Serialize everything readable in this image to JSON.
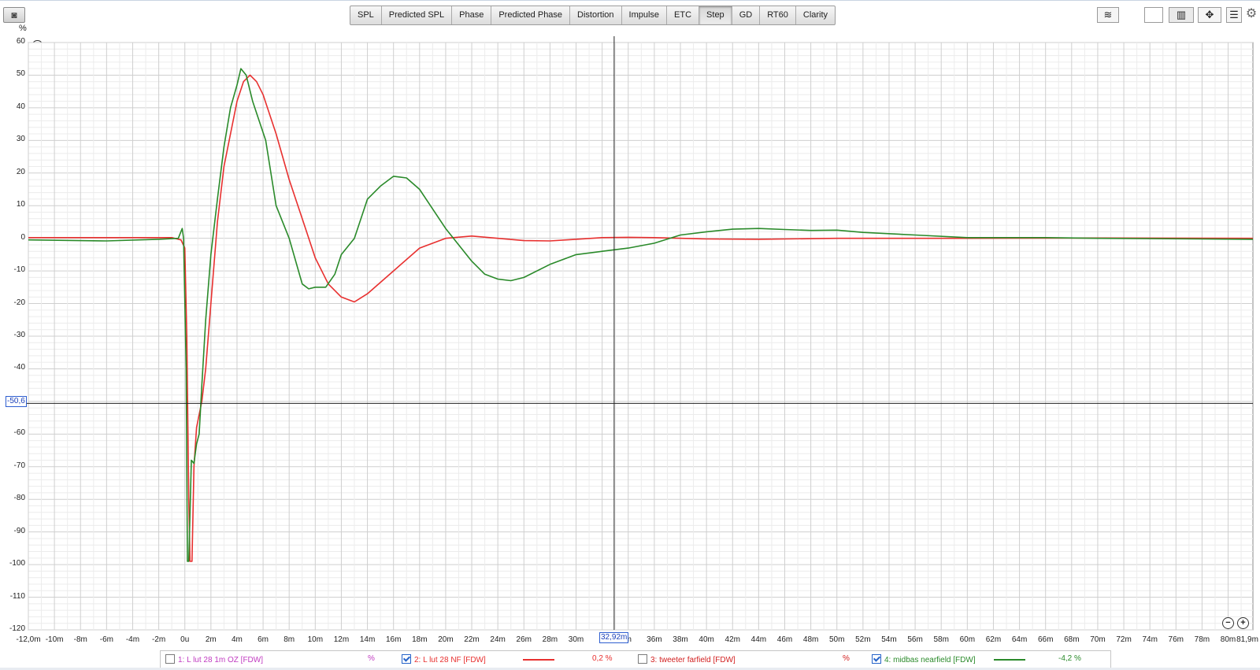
{
  "toolbar": {
    "tabs": [
      {
        "label": "SPL",
        "active": false
      },
      {
        "label": "Predicted SPL",
        "active": false
      },
      {
        "label": "Phase",
        "active": false
      },
      {
        "label": "Predicted Phase",
        "active": false
      },
      {
        "label": "Distortion",
        "active": false
      },
      {
        "label": "Impulse",
        "active": false
      },
      {
        "label": "ETC",
        "active": false
      },
      {
        "label": "Step",
        "active": true
      },
      {
        "label": "GD",
        "active": false
      },
      {
        "label": "RT60",
        "active": false
      },
      {
        "label": "Clarity",
        "active": false
      }
    ]
  },
  "unit_label": "%",
  "unit_select": "%",
  "cursor": {
    "y_readout": "-50,6",
    "x_readout": "32,92m"
  },
  "chart_data": {
    "type": "line",
    "ylim": [
      -120,
      60
    ],
    "xlim": [
      -12.0,
      81.9
    ],
    "grid": true,
    "y_ticks": [
      60,
      50,
      40,
      30,
      20,
      10,
      0,
      -10,
      -20,
      -30,
      -40,
      -50,
      -60,
      -70,
      -80,
      -90,
      -100,
      -110,
      -120
    ],
    "y_tick_labels": [
      "60",
      "50",
      "40",
      "30",
      "20",
      "10",
      "0",
      "-10",
      "-20",
      "-30",
      "-40",
      "",
      "-60",
      "-70",
      "-80",
      "-90",
      "-100",
      "-110",
      "-120"
    ],
    "x_ticks": [
      -12,
      -10,
      -8,
      -6,
      -4,
      -2,
      0,
      2,
      4,
      6,
      8,
      10,
      12,
      14,
      16,
      18,
      20,
      22,
      24,
      26,
      28,
      30,
      32,
      34,
      36,
      38,
      40,
      42,
      44,
      46,
      48,
      50,
      52,
      54,
      56,
      58,
      60,
      62,
      64,
      66,
      68,
      70,
      72,
      74,
      76,
      78,
      80,
      81.9
    ],
    "x_tick_labels": [
      "-12,0m",
      "-10m",
      "-8m",
      "-6m",
      "-4m",
      "-2m",
      "0u",
      "2m",
      "4m",
      "6m",
      "8m",
      "10m",
      "12m",
      "14m",
      "16m",
      "18m",
      "20m",
      "22m",
      "24m",
      "26m",
      "28m",
      "30m",
      "3",
      "m",
      "36m",
      "38m",
      "40m",
      "42m",
      "44m",
      "46m",
      "48m",
      "50m",
      "52m",
      "54m",
      "56m",
      "58m",
      "60m",
      "62m",
      "64m",
      "66m",
      "68m",
      "70m",
      "72m",
      "74m",
      "76m",
      "78m",
      "80m",
      "81,9m"
    ],
    "series": [
      {
        "name": "2: L lut 28 NF [FDW]",
        "color": "#e8302f",
        "points": [
          [
            -12,
            0.2
          ],
          [
            -4,
            0.2
          ],
          [
            -1,
            0.2
          ],
          [
            -0.3,
            -0.5
          ],
          [
            0,
            -3
          ],
          [
            0.15,
            -30
          ],
          [
            0.3,
            -80
          ],
          [
            0.4,
            -99
          ],
          [
            0.55,
            -99
          ],
          [
            0.7,
            -70
          ],
          [
            0.9,
            -58
          ],
          [
            1.05,
            -55
          ],
          [
            1.3,
            -50
          ],
          [
            1.6,
            -40
          ],
          [
            2,
            -20
          ],
          [
            2.5,
            5
          ],
          [
            3,
            22
          ],
          [
            3.5,
            32
          ],
          [
            4,
            42
          ],
          [
            4.5,
            48
          ],
          [
            5,
            50
          ],
          [
            5.5,
            48
          ],
          [
            6,
            44
          ],
          [
            7,
            32
          ],
          [
            8,
            18
          ],
          [
            9,
            6
          ],
          [
            10,
            -6
          ],
          [
            11,
            -14
          ],
          [
            12,
            -18
          ],
          [
            13,
            -19.5
          ],
          [
            14,
            -17
          ],
          [
            16,
            -10
          ],
          [
            18,
            -3
          ],
          [
            20,
            0
          ],
          [
            22,
            0.7
          ],
          [
            24,
            0
          ],
          [
            26,
            -0.7
          ],
          [
            28,
            -0.8
          ],
          [
            30,
            -0.3
          ],
          [
            32,
            0.2
          ],
          [
            34,
            0.3
          ],
          [
            36,
            0.2
          ],
          [
            40,
            -0.2
          ],
          [
            44,
            -0.3
          ],
          [
            50,
            0
          ],
          [
            60,
            0
          ],
          [
            70,
            0.1
          ],
          [
            81.9,
            0
          ]
        ]
      },
      {
        "name": "4: midbas nearfield [FDW]",
        "color": "#2a8a2a",
        "points": [
          [
            -12,
            -0.5
          ],
          [
            -6,
            -0.8
          ],
          [
            -2,
            -0.3
          ],
          [
            -0.5,
            0
          ],
          [
            -0.2,
            3
          ],
          [
            -0.1,
            0
          ],
          [
            0.1,
            -40
          ],
          [
            0.2,
            -99
          ],
          [
            0.3,
            -99
          ],
          [
            0.5,
            -68
          ],
          [
            0.7,
            -69
          ],
          [
            0.9,
            -63
          ],
          [
            1.1,
            -60
          ],
          [
            1.3,
            -45
          ],
          [
            1.6,
            -25
          ],
          [
            2,
            -5
          ],
          [
            2.5,
            12
          ],
          [
            3,
            28
          ],
          [
            3.5,
            40
          ],
          [
            4,
            47
          ],
          [
            4.3,
            52
          ],
          [
            4.7,
            50
          ],
          [
            5.2,
            42
          ],
          [
            5.7,
            36
          ],
          [
            6.2,
            30
          ],
          [
            7,
            10
          ],
          [
            8,
            0
          ],
          [
            9,
            -14
          ],
          [
            9.5,
            -15.5
          ],
          [
            10,
            -15
          ],
          [
            10.8,
            -15
          ],
          [
            11.5,
            -11
          ],
          [
            12,
            -5
          ],
          [
            13,
            0
          ],
          [
            14,
            12
          ],
          [
            15,
            16
          ],
          [
            16,
            19
          ],
          [
            17,
            18.5
          ],
          [
            18,
            15
          ],
          [
            20,
            3
          ],
          [
            22,
            -7
          ],
          [
            23,
            -11
          ],
          [
            24,
            -12.5
          ],
          [
            25,
            -13
          ],
          [
            26,
            -12
          ],
          [
            28,
            -8
          ],
          [
            30,
            -5
          ],
          [
            32,
            -4
          ],
          [
            34,
            -3
          ],
          [
            36,
            -1.5
          ],
          [
            38,
            1
          ],
          [
            40,
            2
          ],
          [
            42,
            2.8
          ],
          [
            44,
            3
          ],
          [
            46,
            2.7
          ],
          [
            48,
            2.4
          ],
          [
            50,
            2.5
          ],
          [
            52,
            1.8
          ],
          [
            56,
            1
          ],
          [
            60,
            0.2
          ],
          [
            66,
            0.2
          ],
          [
            70,
            0
          ],
          [
            81.9,
            -0.3
          ]
        ]
      }
    ]
  },
  "legend": [
    {
      "checked": false,
      "label": "1: L lut 28 1m OZ [FDW]",
      "color": "#c13cc1",
      "value": "%"
    },
    {
      "checked": true,
      "label": "2: L lut 28 NF [FDW]",
      "color": "#e8302f",
      "value": "0,2 %"
    },
    {
      "checked": false,
      "label": "3: tweeter farfield [FDW]",
      "color": "#d22020",
      "value": "%"
    },
    {
      "checked": true,
      "label": "4: midbas nearfield [FDW]",
      "color": "#2a8a2a",
      "value": "-4,2 %"
    }
  ]
}
